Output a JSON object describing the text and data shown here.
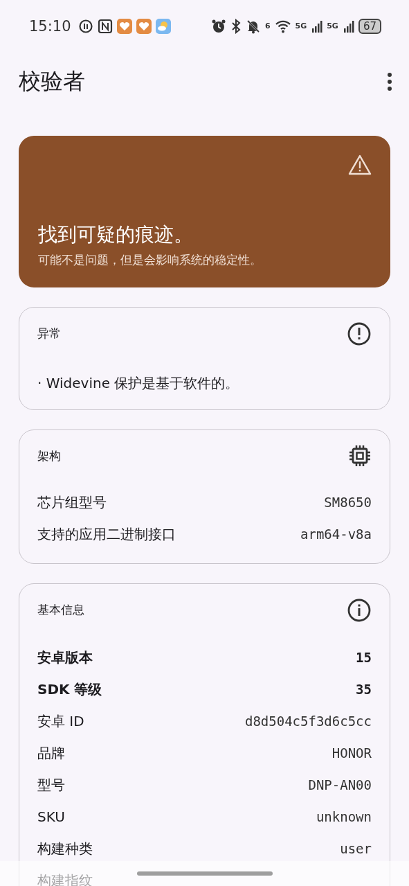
{
  "status_bar": {
    "time": "15:10",
    "wifi_label": "6",
    "sim_labels": [
      "5G",
      "5G"
    ],
    "battery": "67"
  },
  "app_bar": {
    "title": "校验者"
  },
  "alert": {
    "title": "找到可疑的痕迹。",
    "message": "可能不是问题，但是会影响系统的稳定性。"
  },
  "cards": [
    {
      "title": "异常",
      "kind": "bullets",
      "items": [
        "· Widevine 保护是基于软件的。"
      ]
    },
    {
      "title": "架构",
      "kind": "table",
      "rows": [
        {
          "label": "芯片组型号",
          "value": "SM8650",
          "bold": false
        },
        {
          "label": "支持的应用二进制接口",
          "value": "arm64-v8a",
          "bold": false
        }
      ]
    },
    {
      "title": "基本信息",
      "kind": "table",
      "rows": [
        {
          "label": "安卓版本",
          "value": "15",
          "bold": true
        },
        {
          "label": "SDK 等级",
          "value": "35",
          "bold": true
        },
        {
          "label": "安卓 ID",
          "value": "d8d504c5f3d6c5cc",
          "bold": false
        },
        {
          "label": "品牌",
          "value": "HONOR",
          "bold": false
        },
        {
          "label": "型号",
          "value": "DNP-AN00",
          "bold": false
        },
        {
          "label": "SKU",
          "value": "unknown",
          "bold": false
        },
        {
          "label": "构建种类",
          "value": "user",
          "bold": false
        },
        {
          "label": "构建指纹",
          "bold": false
        }
      ]
    }
  ]
}
